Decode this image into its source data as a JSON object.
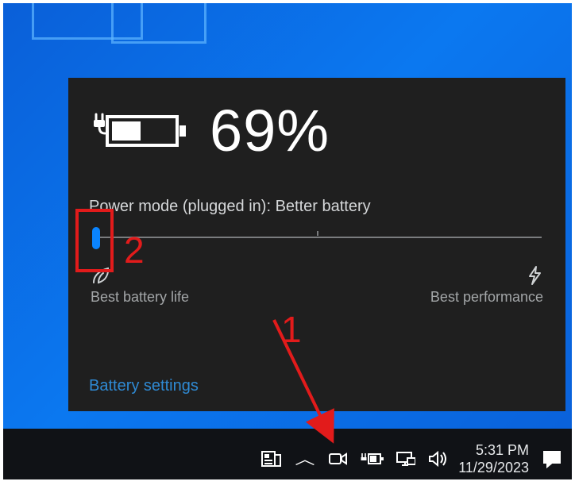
{
  "battery": {
    "percentage_text": "69%",
    "mode_label": "Power mode (plugged in): Better battery",
    "slider": {
      "left_label": "Best battery life",
      "right_label": "Best performance",
      "position_fraction": 0.0,
      "ticks": [
        0.5
      ]
    },
    "settings_link": "Battery settings"
  },
  "taskbar": {
    "time": "5:31 PM",
    "date": "11/29/2023"
  },
  "annotations": {
    "label_1": "1",
    "label_2": "2"
  }
}
